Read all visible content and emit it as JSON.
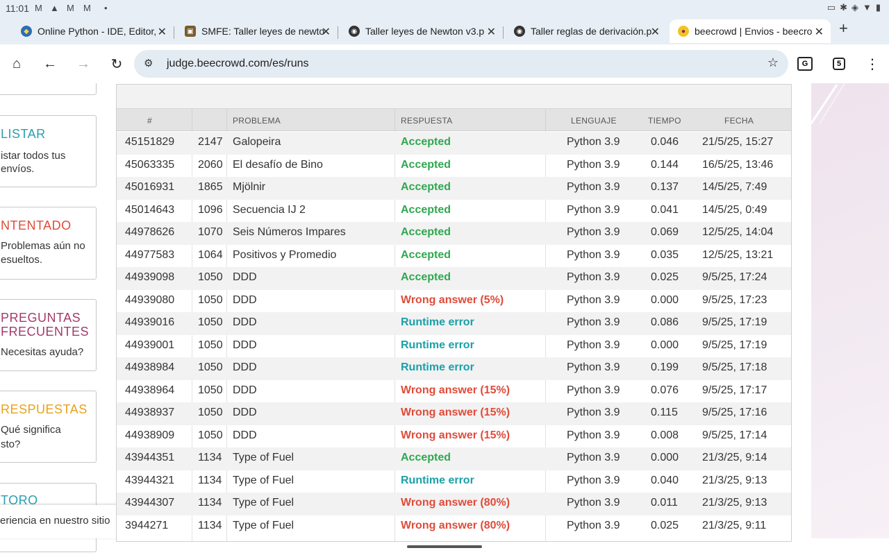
{
  "status": {
    "time": "11:01"
  },
  "tabs": [
    {
      "title": "Online Python - IDE, Editor,",
      "favicon": "python-shield"
    },
    {
      "title": "SMFE: Taller leyes de newto",
      "favicon": "smfe-crest"
    },
    {
      "title": "Taller leyes de Newton v3.p",
      "favicon": "chrome-logo"
    },
    {
      "title": "Taller reglas de derivación.p",
      "favicon": "chrome-logo"
    },
    {
      "title": "beecrowd | Envios - beecro",
      "favicon": "beecrowd-logo",
      "active": true
    }
  ],
  "toolbar": {
    "url": "judge.beecrowd.com/es/runs",
    "tab_count": "5"
  },
  "sidebar": {
    "cards": [
      {
        "title": "LISTAR",
        "desc": [
          "istar todos tus",
          "envíos."
        ],
        "color": "#2a9fb0"
      },
      {
        "title": "NTENTADO",
        "desc": [
          "Problemas aún no",
          "esueltos."
        ],
        "color": "#e04b3a"
      },
      {
        "title": "PREGUNTAS",
        "title2": "FRECUENTES",
        "desc": [
          "Necesitas ayuda?"
        ],
        "color": "#a33a6a"
      },
      {
        "title": "RESPUESTAS",
        "desc": [
          "Qué significa",
          "sto?"
        ],
        "color": "#e8a21a"
      },
      {
        "title": "TORO",
        "desc": [],
        "color": "#2a9fb0"
      }
    ],
    "cookie_text": "eriencia en nuestro sitio"
  },
  "table": {
    "headers": [
      "#",
      "PROBLEMA",
      "RESPUESTA",
      "LENGUAJE",
      "TIEMPO",
      "FECHA"
    ],
    "rows": [
      {
        "id": "45151829",
        "pid": "2147",
        "name": "Galopeira",
        "answer": "Accepted",
        "status": "ok",
        "lang": "Python 3.9",
        "time": "0.046",
        "date": "21/5/25, 15:27"
      },
      {
        "id": "45063335",
        "pid": "2060",
        "name": "El desafío de Bino",
        "answer": "Accepted",
        "status": "ok",
        "lang": "Python 3.9",
        "time": "0.144",
        "date": "16/5/25, 13:46"
      },
      {
        "id": "45016931",
        "pid": "1865",
        "name": "Mjölnir",
        "answer": "Accepted",
        "status": "ok",
        "lang": "Python 3.9",
        "time": "0.137",
        "date": "14/5/25, 7:49"
      },
      {
        "id": "45014643",
        "pid": "1096",
        "name": "Secuencia IJ 2",
        "answer": "Accepted",
        "status": "ok",
        "lang": "Python 3.9",
        "time": "0.041",
        "date": "14/5/25, 0:49"
      },
      {
        "id": "44978626",
        "pid": "1070",
        "name": "Seis Números Impares",
        "answer": "Accepted",
        "status": "ok",
        "lang": "Python 3.9",
        "time": "0.069",
        "date": "12/5/25, 14:04"
      },
      {
        "id": "44977583",
        "pid": "1064",
        "name": "Positivos y Promedio",
        "answer": "Accepted",
        "status": "ok",
        "lang": "Python 3.9",
        "time": "0.035",
        "date": "12/5/25, 13:21"
      },
      {
        "id": "44939098",
        "pid": "1050",
        "name": "DDD",
        "answer": "Accepted",
        "status": "ok",
        "lang": "Python 3.9",
        "time": "0.025",
        "date": "9/5/25, 17:24"
      },
      {
        "id": "44939080",
        "pid": "1050",
        "name": "DDD",
        "answer": "Wrong answer (5%)",
        "status": "wa",
        "lang": "Python 3.9",
        "time": "0.000",
        "date": "9/5/25, 17:23"
      },
      {
        "id": "44939016",
        "pid": "1050",
        "name": "DDD",
        "answer": "Runtime error",
        "status": "re",
        "lang": "Python 3.9",
        "time": "0.086",
        "date": "9/5/25, 17:19"
      },
      {
        "id": "44939001",
        "pid": "1050",
        "name": "DDD",
        "answer": "Runtime error",
        "status": "re",
        "lang": "Python 3.9",
        "time": "0.000",
        "date": "9/5/25, 17:19"
      },
      {
        "id": "44938984",
        "pid": "1050",
        "name": "DDD",
        "answer": "Runtime error",
        "status": "re",
        "lang": "Python 3.9",
        "time": "0.199",
        "date": "9/5/25, 17:18"
      },
      {
        "id": "44938964",
        "pid": "1050",
        "name": "DDD",
        "answer": "Wrong answer (15%)",
        "status": "wa",
        "lang": "Python 3.9",
        "time": "0.076",
        "date": "9/5/25, 17:17"
      },
      {
        "id": "44938937",
        "pid": "1050",
        "name": "DDD",
        "answer": "Wrong answer (15%)",
        "status": "wa",
        "lang": "Python 3.9",
        "time": "0.115",
        "date": "9/5/25, 17:16"
      },
      {
        "id": "44938909",
        "pid": "1050",
        "name": "DDD",
        "answer": "Wrong answer (15%)",
        "status": "wa",
        "lang": "Python 3.9",
        "time": "0.008",
        "date": "9/5/25, 17:14"
      },
      {
        "id": "43944351",
        "pid": "1134",
        "name": "Type of Fuel",
        "answer": "Accepted",
        "status": "ok",
        "lang": "Python 3.9",
        "time": "0.000",
        "date": "21/3/25, 9:14"
      },
      {
        "id": "43944321",
        "pid": "1134",
        "name": "Type of Fuel",
        "answer": "Runtime error",
        "status": "re",
        "lang": "Python 3.9",
        "time": "0.040",
        "date": "21/3/25, 9:13"
      },
      {
        "id": "43944307",
        "pid": "1134",
        "name": "Type of Fuel",
        "answer": "Wrong answer (80%)",
        "status": "wa",
        "lang": "Python 3.9",
        "time": "0.011",
        "date": "21/3/25, 9:13"
      },
      {
        "id": "3944271",
        "pid": "1134",
        "name": "Type of Fuel",
        "answer": "Wrong answer (80%)",
        "status": "wa",
        "lang": "Python 3.9",
        "time": "0.025",
        "date": "21/3/25, 9:11"
      }
    ]
  }
}
